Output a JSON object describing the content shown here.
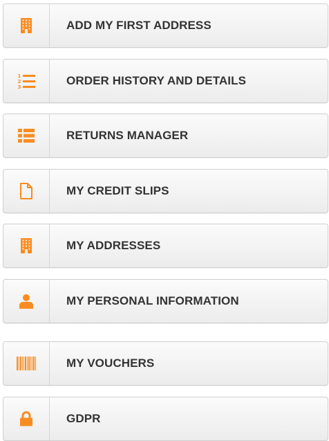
{
  "colors": {
    "accent": "#f98c21",
    "text": "#333333"
  },
  "menu": {
    "items": [
      {
        "id": "add-first-address",
        "label": "ADD MY FIRST ADDRESS",
        "icon": "building-icon"
      },
      {
        "id": "order-history",
        "label": "ORDER HISTORY AND DETAILS",
        "icon": "numbered-list-icon"
      },
      {
        "id": "returns-manager",
        "label": "RETURNS MANAGER",
        "icon": "list-icon"
      },
      {
        "id": "credit-slips",
        "label": "MY CREDIT SLIPS",
        "icon": "file-icon"
      },
      {
        "id": "my-addresses",
        "label": "MY ADDRESSES",
        "icon": "building-icon"
      },
      {
        "id": "personal-information",
        "label": "MY PERSONAL INFORMATION",
        "icon": "user-icon"
      },
      {
        "id": "vouchers",
        "label": "MY VOUCHERS",
        "icon": "barcode-icon"
      },
      {
        "id": "gdpr",
        "label": "GDPR",
        "icon": "lock-icon"
      }
    ]
  }
}
